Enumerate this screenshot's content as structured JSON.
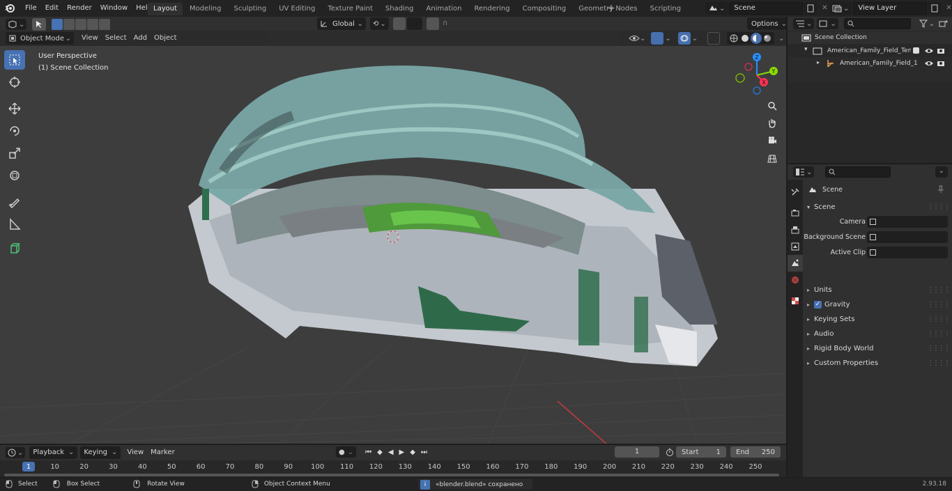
{
  "top_menu": [
    "File",
    "Edit",
    "Render",
    "Window",
    "Help"
  ],
  "workspace_tabs": [
    {
      "label": "Layout",
      "active": true
    },
    {
      "label": "Modeling"
    },
    {
      "label": "Sculpting"
    },
    {
      "label": "UV Editing"
    },
    {
      "label": "Texture Paint"
    },
    {
      "label": "Shading"
    },
    {
      "label": "Animation"
    },
    {
      "label": "Rendering"
    },
    {
      "label": "Compositing"
    },
    {
      "label": "Geometry Nodes"
    },
    {
      "label": "Scripting"
    }
  ],
  "scene_selector": {
    "value": "Scene"
  },
  "view_layer_selector": {
    "value": "View Layer"
  },
  "viewport": {
    "mode": "Object Mode",
    "menus": [
      "View",
      "Select",
      "Add",
      "Object"
    ],
    "transform_orientation": "Global",
    "options_label": "Options",
    "overlay_title": "User Perspective",
    "overlay_subtitle": "(1) Scene Collection"
  },
  "gizmo_axes": {
    "z": "Z",
    "y": "Y",
    "x": "X"
  },
  "outliner": {
    "root": "Scene Collection",
    "items": [
      {
        "label": "American_Family_Field_Tenni",
        "depth": 1
      },
      {
        "label": "American_Family_Field_1",
        "depth": 2
      }
    ]
  },
  "properties": {
    "context_label": "Scene",
    "panel_title": "Scene",
    "fields": [
      {
        "label": "Camera"
      },
      {
        "label": "Background Scene"
      },
      {
        "label": "Active Clip"
      }
    ],
    "panels": [
      {
        "label": "Units",
        "checkbox": false
      },
      {
        "label": "Gravity",
        "checkbox": true
      },
      {
        "label": "Keying Sets",
        "checkbox": false
      },
      {
        "label": "Audio",
        "checkbox": false
      },
      {
        "label": "Rigid Body World",
        "checkbox": false
      },
      {
        "label": "Custom Properties",
        "checkbox": false
      }
    ]
  },
  "timeline": {
    "menus": [
      "Playback",
      "Keying",
      "View",
      "Marker"
    ],
    "current_frame": "1",
    "start_label": "Start",
    "start_value": "1",
    "end_label": "End",
    "end_value": "250",
    "ticks": [
      "1",
      "10",
      "20",
      "30",
      "40",
      "50",
      "60",
      "70",
      "80",
      "90",
      "100",
      "110",
      "120",
      "130",
      "140",
      "150",
      "160",
      "170",
      "180",
      "190",
      "200",
      "210",
      "220",
      "230",
      "240",
      "250"
    ]
  },
  "statusbar": {
    "select": "Select",
    "box_select": "Box Select",
    "rotate_view": "Rotate View",
    "context_menu": "Object Context Menu",
    "message": "«blender.blend» сохранено",
    "version": "2.93.18"
  },
  "colors": {
    "accent": "#4772b3",
    "axis_x": "#ff3352",
    "axis_y": "#8bdc00",
    "axis_z": "#2890ff"
  }
}
